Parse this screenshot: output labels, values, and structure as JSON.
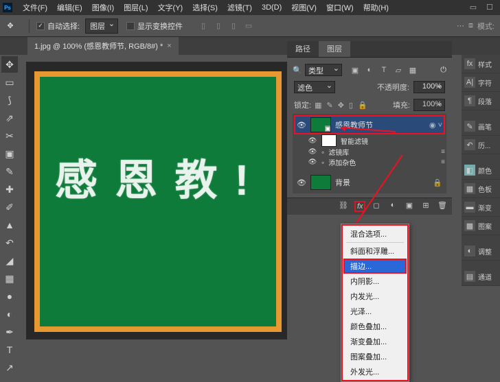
{
  "menubar": {
    "items": [
      "文件(F)",
      "编辑(E)",
      "图像(I)",
      "图层(L)",
      "文字(Y)",
      "选择(S)",
      "滤镜(T)",
      "3D(D)",
      "视图(V)",
      "窗口(W)",
      "帮助(H)"
    ]
  },
  "optionsbar": {
    "auto_select_label": "自动选择:",
    "auto_select_value": "图层",
    "show_transform_label": "显示变换控件",
    "mode_label": "模式:"
  },
  "doctab": {
    "title": "1.jpg @ 100% (感恩教师节, RGB/8#) *"
  },
  "panels": {
    "tabs_top": {
      "path": "路径",
      "layers": "图层"
    },
    "filter": {
      "type": "类型"
    },
    "blend": {
      "mode": "滤色",
      "opacity_label": "不透明度:",
      "opacity_value": "100%",
      "lock_label": "锁定:",
      "fill_label": "填充:",
      "fill_value": "100%"
    },
    "layers": {
      "l0": "感恩教师节",
      "l1": "智能滤镜",
      "l2": "滤镜库",
      "l3": "添加杂色",
      "bg": "背景"
    }
  },
  "fx_menu": {
    "items": [
      "混合选项...",
      "斜面和浮雕...",
      "描边...",
      "内阴影...",
      "内发光...",
      "光泽...",
      "颜色叠加...",
      "渐变叠加...",
      "图案叠加...",
      "外发光..."
    ]
  },
  "right_col": {
    "items": [
      "样式",
      "字符",
      "段落",
      "画笔",
      "历...",
      "颜色",
      "色板",
      "渐变",
      "图案",
      "调整",
      "通道"
    ]
  },
  "canvas_text": "感 恩 教 !"
}
